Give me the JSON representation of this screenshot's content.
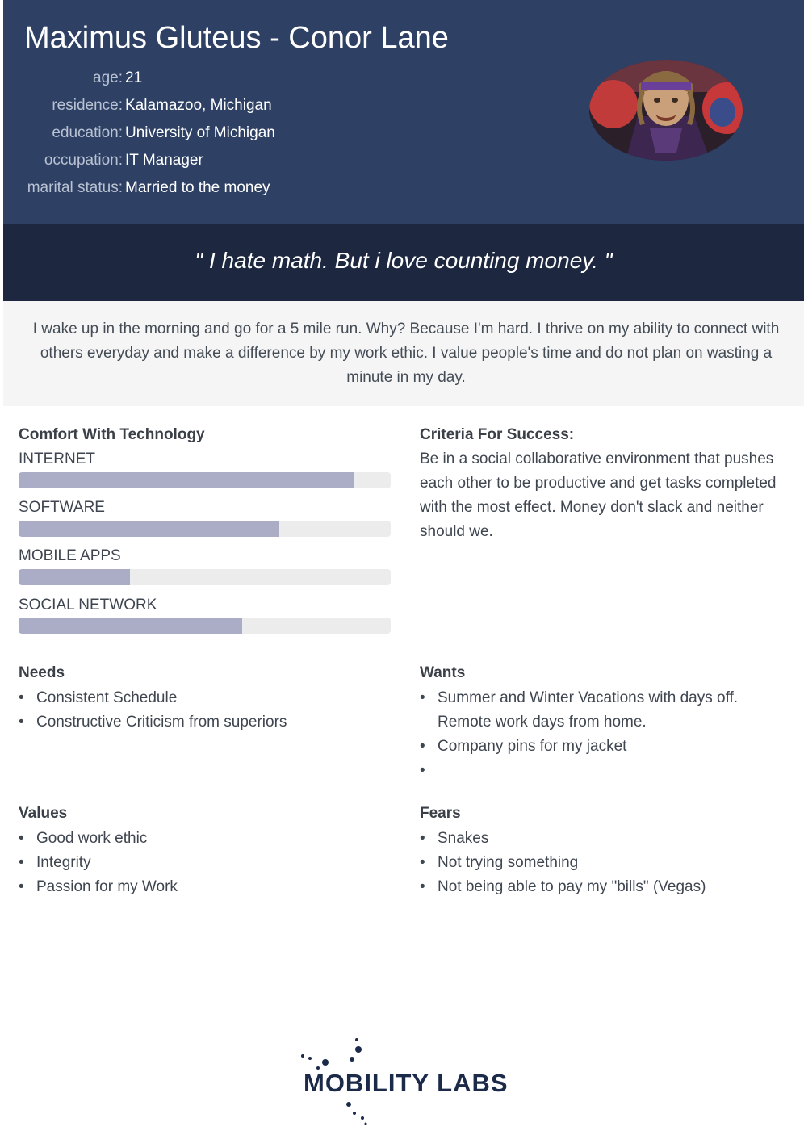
{
  "header": {
    "name": "Maximus Gluteus - Conor Lane",
    "facts": [
      {
        "label": "age:",
        "value": "21"
      },
      {
        "label": "residence:",
        "value": "Kalamazoo, Michigan"
      },
      {
        "label": "education:",
        "value": "University of Michigan"
      },
      {
        "label": "occupation:",
        "value": "IT Manager"
      },
      {
        "label": "marital status:",
        "value": "Married to the money"
      }
    ]
  },
  "quote": "\" I hate math. But i love counting money. \"",
  "bio": "I wake up in the morning and go for a 5 mile run. Why? Because I'm hard. I thrive on my ability to connect with others everyday and make a difference by my work ethic. I value people's time and do not plan on wasting a minute in my day.",
  "technology": {
    "title": "Comfort With Technology",
    "skills": [
      {
        "label": "INTERNET",
        "level": 0.9
      },
      {
        "label": "SOFTWARE",
        "level": 0.7
      },
      {
        "label": "MOBILE APPS",
        "level": 0.3
      },
      {
        "label": "SOCIAL NETWORK",
        "level": 0.6
      }
    ]
  },
  "criteria": {
    "title": "Criteria For Success:",
    "text": "Be in a social collaborative environment that pushes each other to be productive and get tasks completed with the most effect. Money don't slack and neither should we."
  },
  "needs": {
    "title": "Needs",
    "items": [
      "Consistent Schedule",
      "Constructive Criticism from superiors"
    ]
  },
  "wants": {
    "title": "Wants",
    "items": [
      "Summer and Winter Vacations with days off. Remote work days from home.",
      "Company pins for my jacket",
      ""
    ]
  },
  "values": {
    "title": "Values",
    "items": [
      "Good work ethic",
      "Integrity",
      "Passion for my Work"
    ]
  },
  "fears": {
    "title": "Fears",
    "items": [
      "Snakes",
      "Not trying something",
      "Not being able to pay my \"bills\" (Vegas)"
    ]
  },
  "logo": {
    "text": "MOBILITY LABS"
  },
  "colors": {
    "header": "#2e4164",
    "quote_band": "#1d2840",
    "bar_fill": "#abadc7",
    "bar_track": "#ececec"
  }
}
